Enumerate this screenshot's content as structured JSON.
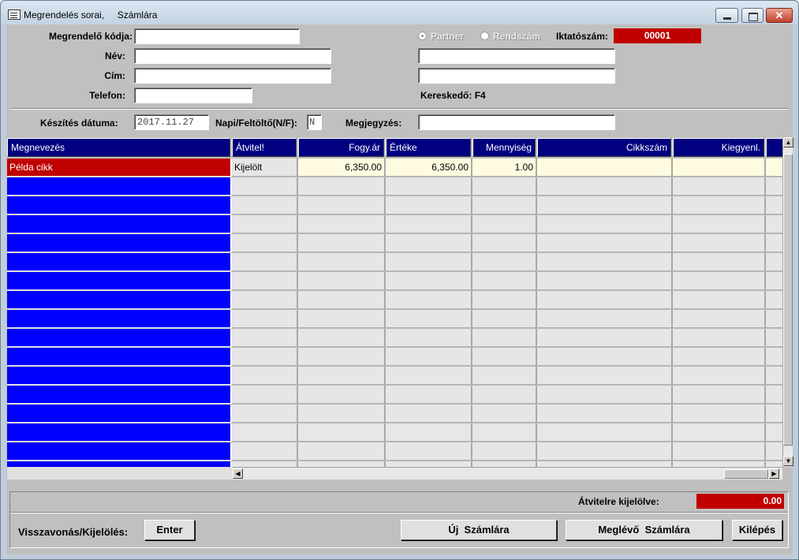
{
  "window": {
    "title": "Megrendelés sorai,     Számlára",
    "close_glyph": "✕"
  },
  "form": {
    "customer_code_label": "Megrendelő kódja:",
    "customer_code_value": "",
    "name_label": "Név:",
    "name_value": "",
    "address_label": "Cím:",
    "address_value": "",
    "phone_label": "Telefon:",
    "phone_value": "",
    "radio_partner_label": "Partner",
    "radio_plate_label": "Rendszám",
    "selected_radio": "partner",
    "reg_number_label": "Iktatószám:",
    "reg_number_value": "00001",
    "extra_field_1": "",
    "extra_field_2": "",
    "dealer_label": "Kereskedő: F4",
    "created_date_label": "Készítés dátuma:",
    "created_date_value": "2017.11.27",
    "daily_label": "Napi/Feltöltő(N/F):",
    "daily_value": "N",
    "note_label": "Megjegyzés:",
    "note_value": ""
  },
  "table": {
    "columns": [
      "Megnevezés",
      "Átvitel!",
      "Fogy.ár",
      "Értéke",
      "Mennyiség",
      "Cikkszám",
      "Kiegyenl.",
      ""
    ],
    "rows": [
      [
        "Példa cikk",
        "Kijelölt",
        "6,350.00",
        "6,350.00",
        "1.00",
        "",
        "",
        ""
      ]
    ],
    "empty_rows": 16
  },
  "footer": {
    "transfer_label": "Átvitelre kijelölve:",
    "transfer_value": "0.00",
    "undo_label": "Visszavonás/Kijelölés:",
    "enter_button": "Enter",
    "new_invoice_button": "Új  Számlára",
    "existing_invoice_button": "Meglévő  Számlára",
    "exit_button": "Kilépés"
  },
  "colors": {
    "header_bg": "#000080",
    "name_cell_bg": "#0000ff",
    "selected_row_bg": "#c00000",
    "highlight_cell_bg": "#fffbe0"
  }
}
